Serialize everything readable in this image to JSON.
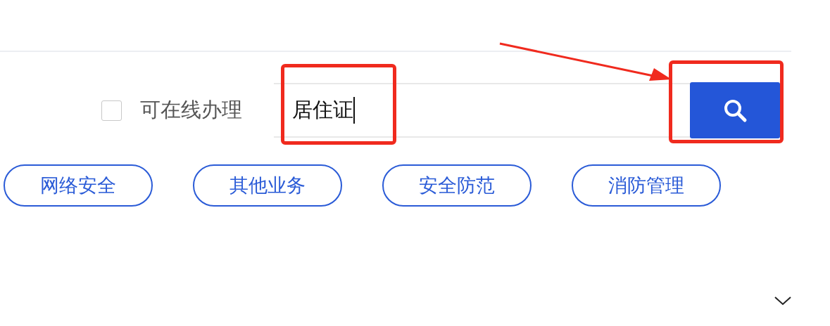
{
  "online_filter": {
    "label": "可在线办理",
    "checked": false
  },
  "search": {
    "value": "居住证"
  },
  "tags": [
    {
      "label": "网络安全"
    },
    {
      "label": "其他业务"
    },
    {
      "label": "安全防范"
    },
    {
      "label": "消防管理"
    }
  ]
}
